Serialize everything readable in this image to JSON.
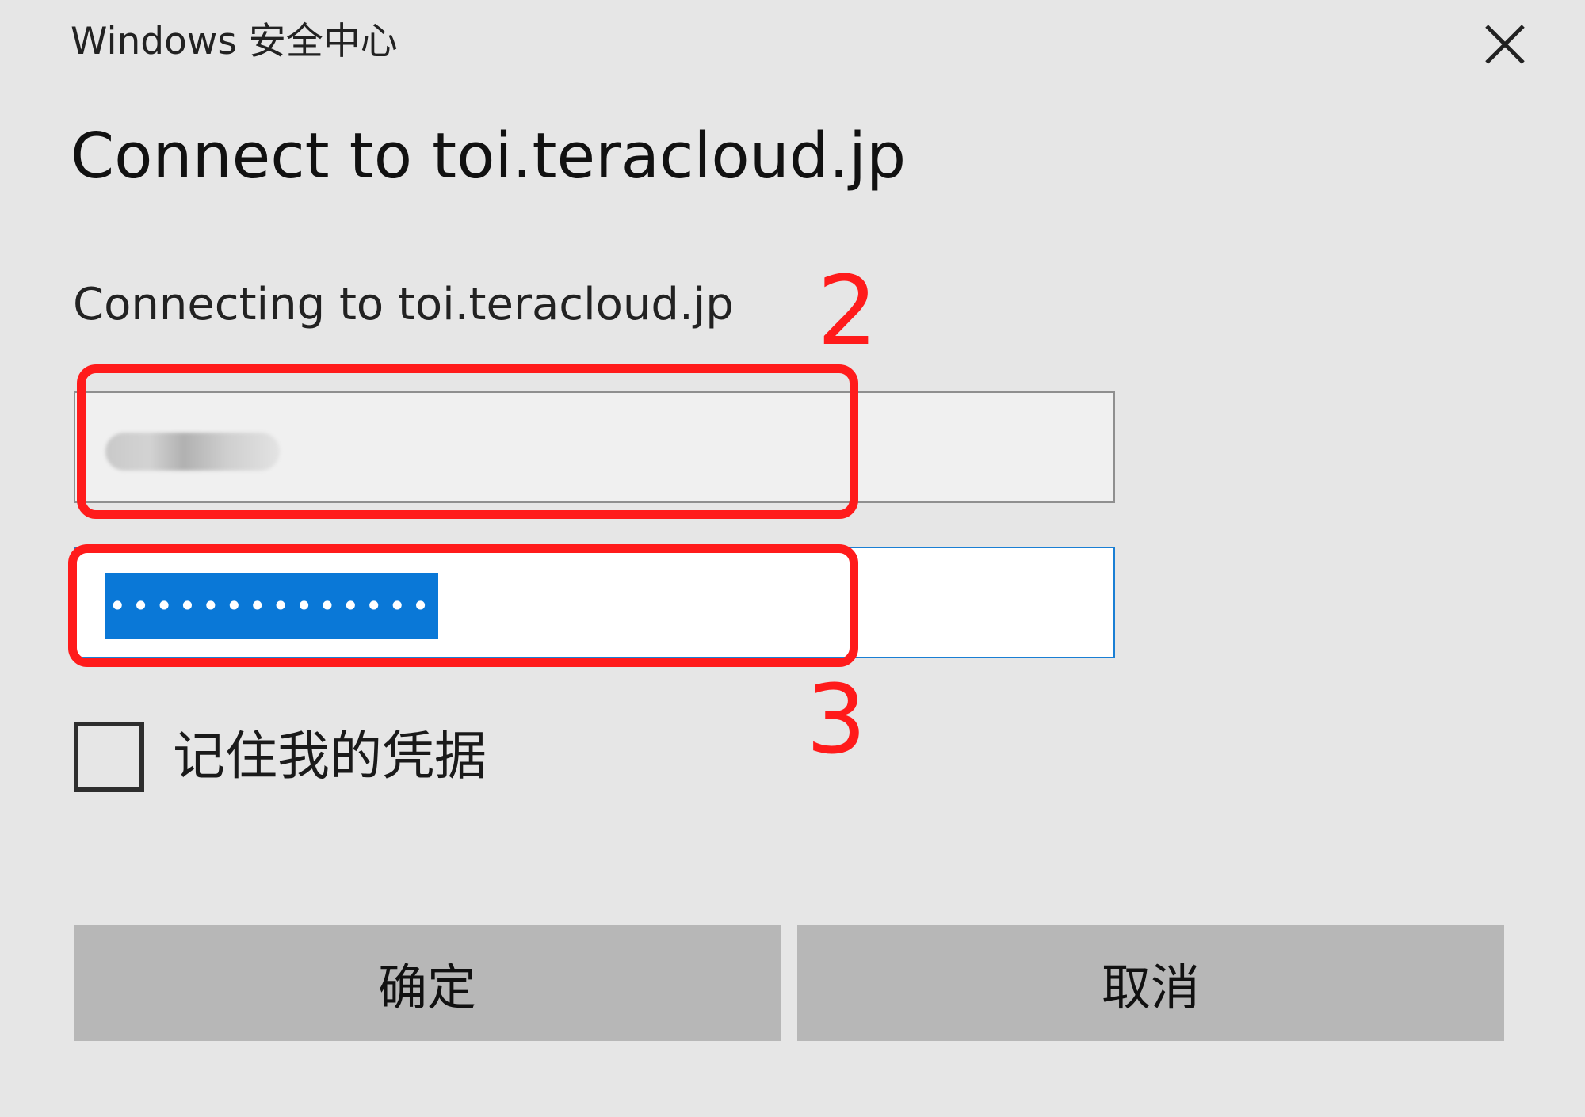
{
  "window": {
    "title": "Windows 安全中心",
    "close_icon": "close-icon"
  },
  "dialog": {
    "heading": "Connect to toi.teracloud.jp",
    "message": "Connecting to toi.teracloud.jp"
  },
  "username": {
    "value_obscured": true
  },
  "password": {
    "masked_value": "••••••••••••••",
    "selected": true
  },
  "annotations": {
    "box_2_label": "2",
    "box_3_label": "3",
    "color": "#ff1b1b"
  },
  "remember": {
    "label": "记住我的凭据",
    "checked": false
  },
  "buttons": {
    "ok_label": "确定",
    "cancel_label": "取消"
  },
  "colors": {
    "background": "#e6e6e6",
    "focus_border": "#1a7fd4",
    "selection": "#0a78d7",
    "button": "#b7b7b7"
  }
}
